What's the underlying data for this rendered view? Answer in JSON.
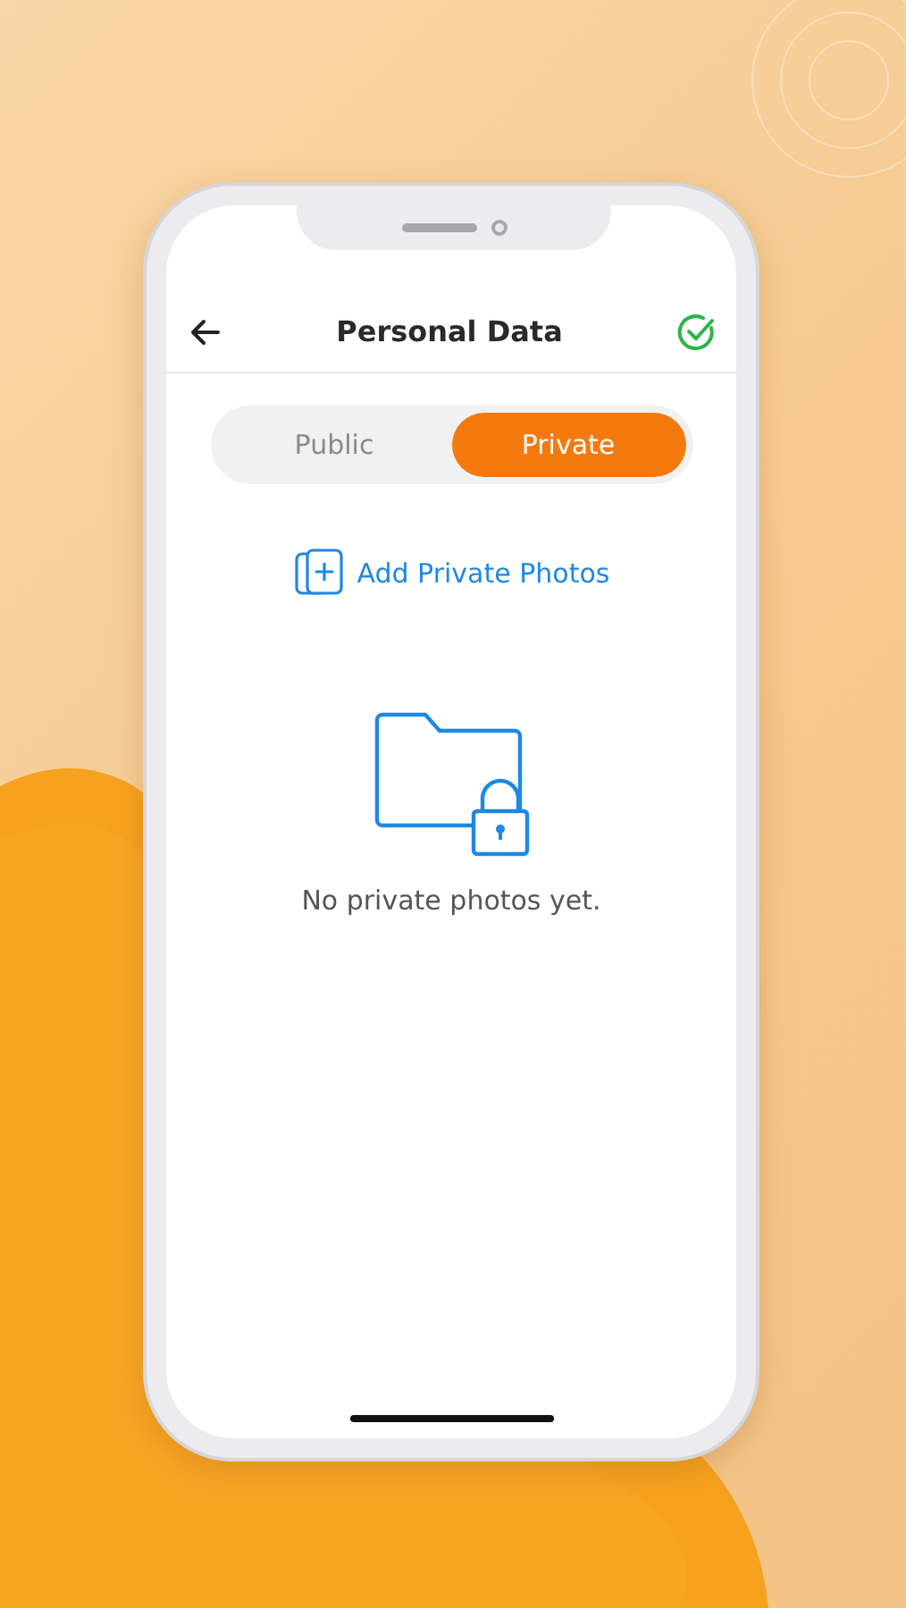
{
  "header": {
    "title": "Personal Data"
  },
  "tabs": [
    {
      "label": "Public",
      "selected": false
    },
    {
      "label": "Private",
      "selected": true
    }
  ],
  "add_action": {
    "label": "Add Private Photos"
  },
  "empty_state": {
    "message": "No private photos yet."
  }
}
